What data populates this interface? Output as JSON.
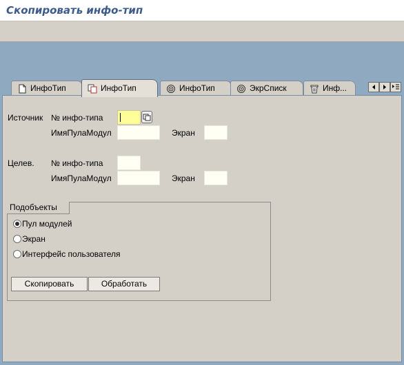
{
  "window": {
    "title": "Скопировать инфо-тип"
  },
  "tabs": [
    {
      "label": "ИнфоТип",
      "icon": "new-document-icon",
      "active": false
    },
    {
      "label": "ИнфоТип",
      "icon": "copy-icon",
      "active": true
    },
    {
      "label": "ИнфоТип",
      "icon": "rename-icon",
      "active": false
    },
    {
      "label": "ЭкрСписк",
      "icon": "rename-icon",
      "active": false
    },
    {
      "label": "Инф...",
      "icon": "delete-icon",
      "active": false
    }
  ],
  "tab_nav": {
    "left": "scroll-left-icon",
    "right": "scroll-right-icon",
    "list": "tab-list-icon"
  },
  "source": {
    "label": "Источник",
    "infotype_label": "№ инфо-типа",
    "infotype_value": "",
    "module_pool_label": "ИмяПулаМодул",
    "module_pool_value": "",
    "screen_label": "Экран",
    "screen_value": ""
  },
  "target": {
    "label": "Целев.",
    "infotype_label": "№ инфо-типа",
    "infotype_value": "",
    "module_pool_label": "ИмяПулаМодул",
    "module_pool_value": "",
    "screen_label": "Экран",
    "screen_value": ""
  },
  "subobjects": {
    "title": "Подобъекты",
    "options": [
      {
        "label": "Пул модулей",
        "checked": true
      },
      {
        "label": "Экран",
        "checked": false
      },
      {
        "label": "Интерфейс пользователя",
        "checked": false
      }
    ],
    "copy_button": "Скопировать",
    "process_button": "Обработать"
  },
  "colors": {
    "title_text": "#3c5a8c",
    "work_area": "#8fa9c0",
    "panel": "#d4d0c8",
    "input_focused": "#ffff99",
    "input": "#fffff4"
  }
}
